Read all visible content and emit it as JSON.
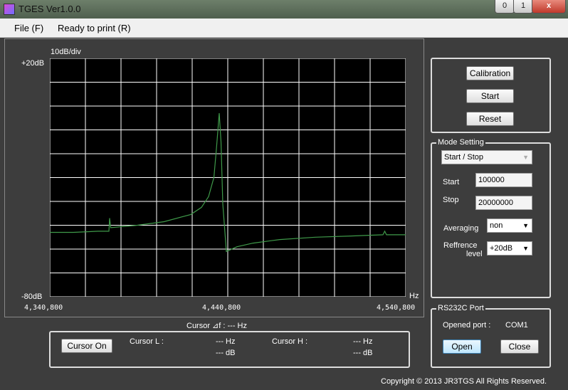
{
  "window": {
    "title": "TGES Ver1.0.0",
    "min": "0",
    "max": "1",
    "close": "x"
  },
  "menu": {
    "file": "File (F)",
    "print": "Ready to print (R)"
  },
  "plot": {
    "scale_label": "10dB/div",
    "y_top": "+20dB",
    "y_bottom": "-80dB",
    "x_unit": "Hz",
    "x_ticks": [
      "4,340,800",
      "4,440,800",
      "4,540,800"
    ],
    "trace_color": "#3f9a4a",
    "grid_color": "#ffffff"
  },
  "chart_data": {
    "type": "line",
    "xlim": [
      4340800,
      4540800
    ],
    "ylim": [
      -80,
      20
    ],
    "x": [
      4340800,
      4354000,
      4368000,
      4374000,
      4374400,
      4375000,
      4390000,
      4405000,
      4420000,
      4426000,
      4430000,
      4433000,
      4434500,
      4436000,
      4437000,
      4438000,
      4440000,
      4446000,
      4455000,
      4470000,
      4490000,
      4510000,
      4528000,
      4529000,
      4530000,
      4540800
    ],
    "y": [
      -53,
      -53,
      -52.5,
      -52.5,
      -47,
      -51,
      -50,
      -48.5,
      -45.5,
      -42.5,
      -38,
      -30,
      -17,
      -3,
      -15,
      -41,
      -61,
      -59,
      -57.5,
      -56,
      -55,
      -54.5,
      -54,
      -52.5,
      -54,
      -54
    ]
  },
  "cursor": {
    "title": "Cursor ⊿f : --- Hz",
    "button": "Cursor On",
    "l_label": "Cursor L :",
    "l_hz": "--- Hz",
    "l_db": "--- dB",
    "h_label": "Cursor H :",
    "h_hz": "--- Hz",
    "h_db": "--- dB"
  },
  "actions": {
    "calibration": "Calibration",
    "start": "Start",
    "reset": "Reset"
  },
  "mode": {
    "legend": "Mode Setting",
    "mode_value": "Start / Stop",
    "start_label": "Start",
    "start_value": "100000",
    "stop_label": "Stop",
    "stop_value": "20000000",
    "averaging_label": "Averaging",
    "averaging_value": "non",
    "ref_label_1": "Reffrence",
    "ref_label_2": "level",
    "ref_value": "+20dB"
  },
  "port": {
    "legend": "RS232C Port",
    "opened_label": "Opened port :",
    "opened_value": "COM1",
    "open": "Open",
    "close": "Close"
  },
  "footer": {
    "copyright": "Copyright © 2013 JR3TGS All Rights Reserved."
  }
}
